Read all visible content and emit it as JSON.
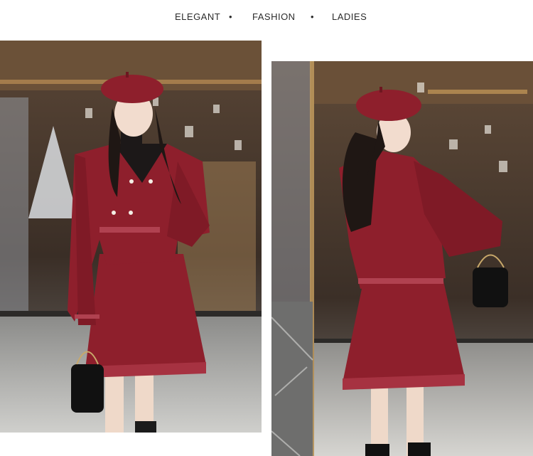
{
  "header": {
    "tags": [
      "ELEGANT",
      "FASHION",
      "LADIES"
    ],
    "separator": "•"
  },
  "photos": {
    "left": {
      "subject": "model-front-view"
    },
    "right": {
      "subject": "model-back-view"
    }
  },
  "colors": {
    "accent": "#8e1f2c",
    "background": "#ffffff",
    "text": "#2b2b2b"
  }
}
